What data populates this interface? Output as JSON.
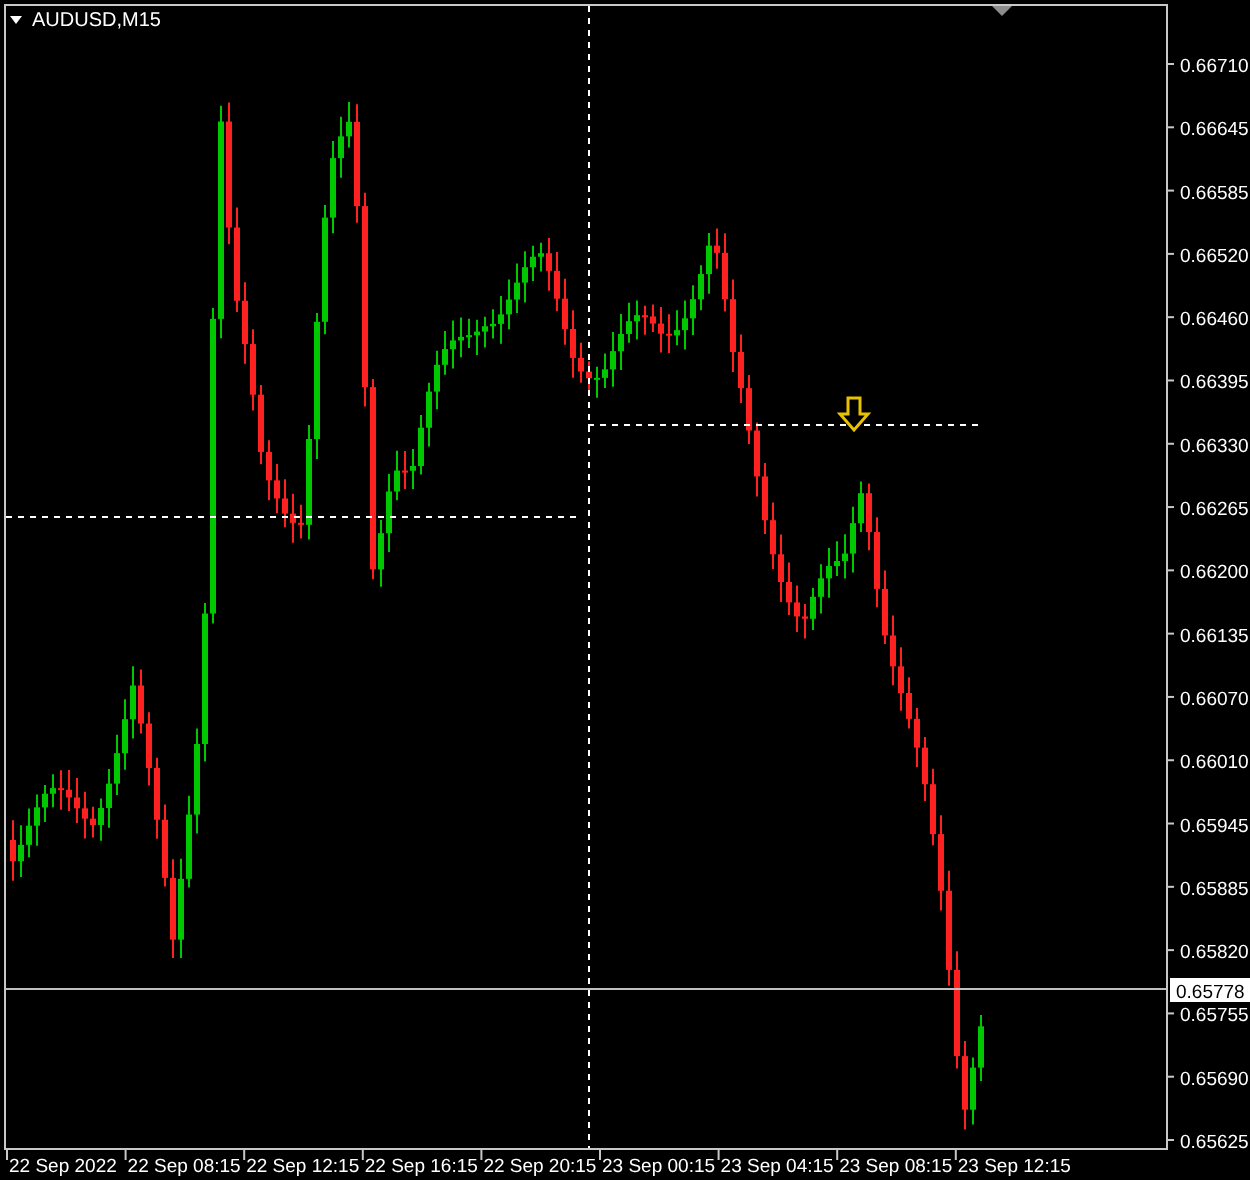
{
  "chart": {
    "title": "AUDUSD,M15",
    "price_labels": [
      "0.66710",
      "0.66645",
      "0.66585",
      "0.66520",
      "0.66460",
      "0.66395",
      "0.66330",
      "0.66265",
      "0.66200",
      "0.66135",
      "0.66070",
      "0.66010",
      "0.65945",
      "0.65885",
      "0.65820",
      "0.65755",
      "0.65690",
      "0.65625"
    ],
    "current_price": "0.65778",
    "time_labels": [
      "22 Sep 2022",
      "22 Sep 08:15",
      "22 Sep 12:15",
      "22 Sep 16:15",
      "22 Sep 20:15",
      "23 Sep 00:15",
      "23 Sep 04:15",
      "23 Sep 08:15",
      "23 Sep 12:15"
    ]
  }
}
